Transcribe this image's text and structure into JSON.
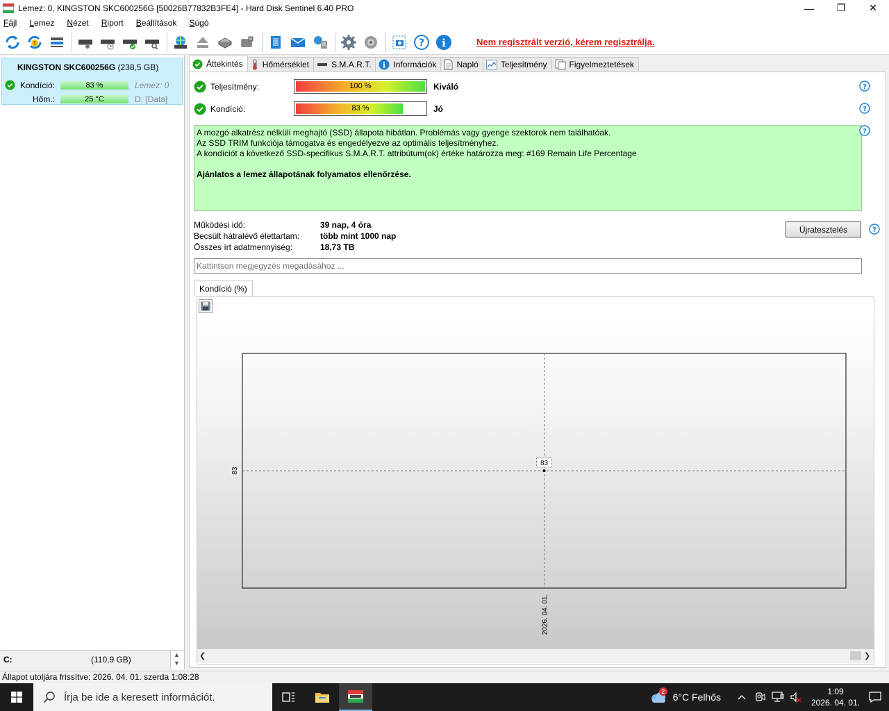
{
  "window": {
    "title": "Lemez: 0, KINGSTON SKC600256G [50026B77832B3FE4]  -  Hard Disk Sentinel 6.40 PRO",
    "minimize": "—",
    "restore": "❐",
    "close": "✕"
  },
  "menu": [
    {
      "accel": "F",
      "rest": "ájl"
    },
    {
      "accel": "L",
      "rest": "emez"
    },
    {
      "accel": "N",
      "rest": "ézet"
    },
    {
      "accel": "R",
      "rest": "iport"
    },
    {
      "accel": "B",
      "rest": "eállítások"
    },
    {
      "accel": "S",
      "rest": "úgó"
    }
  ],
  "toolbar": {
    "unregistered": "Nem regisztrált verzió, kérem regisztrálja."
  },
  "disk": {
    "name": "KINGSTON SKC600256G",
    "size": "(238,5 GB)",
    "condition_label": "Kondíció:",
    "condition_value": "83 %",
    "disk_index": "Lemez: 0",
    "temp_label": "Hőm.:",
    "temp_value": "25 °C",
    "drive_letter": "D:",
    "drive_name": "[Data]"
  },
  "volume": {
    "letter": "C:",
    "size": "(110,9 GB)",
    "up": "▲",
    "down": "▼"
  },
  "tabs": [
    {
      "label": "Áttekintés",
      "icon": "check-circle-icon",
      "active": true
    },
    {
      "label": "Hőmérséklet",
      "icon": "thermometer-icon",
      "active": false
    },
    {
      "label": "S.M.A.R.T.",
      "icon": "smart-icon",
      "active": false
    },
    {
      "label": "Információk",
      "icon": "info-icon",
      "active": false
    },
    {
      "label": "Napló",
      "icon": "log-icon",
      "active": false
    },
    {
      "label": "Teljesítmény",
      "icon": "performance-icon",
      "active": false
    },
    {
      "label": "Figyelmeztetések",
      "icon": "alerts-icon",
      "active": false
    }
  ],
  "overview": {
    "performance_label": "Teljesítmény:",
    "performance_value": "100 %",
    "performance_fraction": 1.0,
    "performance_rating": "Kiváló",
    "condition_label": "Kondíció:",
    "condition_value": "83 %",
    "condition_fraction": 0.83,
    "condition_rating": "Jó",
    "message_lines": [
      "A mozgó alkatrész nélküli meghajtó (SSD) állapota hibátlan. Problémás vagy gyenge szektorok nem találhatóak.",
      "Az SSD TRIM funkciója támogatva és engedélyezve az optimális teljesítményhez.",
      "A kondíciót a következő SSD-specifikus S.M.A.R.T. attribútum(ok) értéke határozza meg:  #169 Remain Life Percentage"
    ],
    "message_bold": "Ajánlatos a lemez állapotának folyamatos ellenőrzése.",
    "info": [
      {
        "key": "Működési idő:",
        "value": "39 nap, 4 óra"
      },
      {
        "key": "Becsült hátralévő élettartam:",
        "value": "több mint 1000 nap"
      },
      {
        "key": "Összes írt adatmennyiség:",
        "value": "18,73 TB"
      }
    ],
    "retest_button": "Újratesztelés",
    "note_placeholder": "Kattintson megjegyzés megadásához ..."
  },
  "chart_tab": "Kondíció  (%)",
  "chart_data": {
    "type": "line",
    "title": "",
    "xlabel": "",
    "ylabel": "",
    "x": [
      "2026. 04. 01."
    ],
    "series": [
      {
        "values": [
          83
        ]
      }
    ],
    "y_tick": "83",
    "data_label": "83",
    "grid": false
  },
  "statusbar": "Állapot utoljára frissítve: 2026. 04. 01. szerda 1:08:28",
  "taskbar": {
    "search_placeholder": "Írja be ide a keresett információt.",
    "weather_badge": "2",
    "weather": "6°C  Felhős",
    "time": "1:09",
    "date": "2026. 04. 01."
  },
  "colors": {
    "accent": "#0078d7",
    "ok_green": "#1ea51e",
    "warning_red": "#d91e18",
    "message_bg": "#c0ffc0",
    "disk_card_bg": "#cdeffb"
  }
}
